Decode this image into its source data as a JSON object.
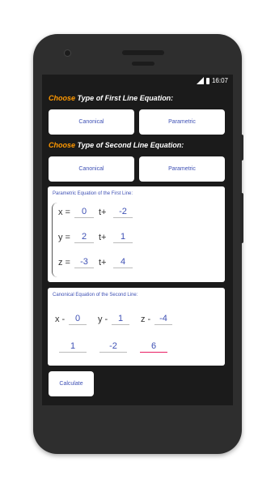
{
  "statusbar": {
    "time": "16:07"
  },
  "first_line": {
    "heading_accent": "Choose",
    "heading_rest": " Type of First Line Equation:",
    "canonical_label": "Canonical",
    "parametric_label": "Parametric"
  },
  "second_line": {
    "heading_accent": "Choose",
    "heading_rest": " Type of Second Line Equation:",
    "canonical_label": "Canonical",
    "parametric_label": "Parametric"
  },
  "parametric_card": {
    "title": "Parametric Equation of the First Line:",
    "rows": [
      {
        "var": "x =",
        "a": "0",
        "op": "t+",
        "b": "-2"
      },
      {
        "var": "y =",
        "a": "2",
        "op": "t+",
        "b": "1"
      },
      {
        "var": "z =",
        "a": "-3",
        "op": "t+",
        "b": "4"
      }
    ]
  },
  "canonical_card": {
    "title": "Canonical Equation of the Second Line:",
    "numer": [
      {
        "var": "x -",
        "val": "0"
      },
      {
        "var": "y -",
        "val": "1"
      },
      {
        "var": "z -",
        "val": "-4"
      }
    ],
    "denom": [
      "1",
      "-2",
      "6"
    ]
  },
  "calculate_label": "Calculate",
  "colors": {
    "accent": "#ff9800",
    "value": "#3f51b5",
    "screen_bg": "#1b1b1b",
    "focus_underline": "#e91e63"
  }
}
